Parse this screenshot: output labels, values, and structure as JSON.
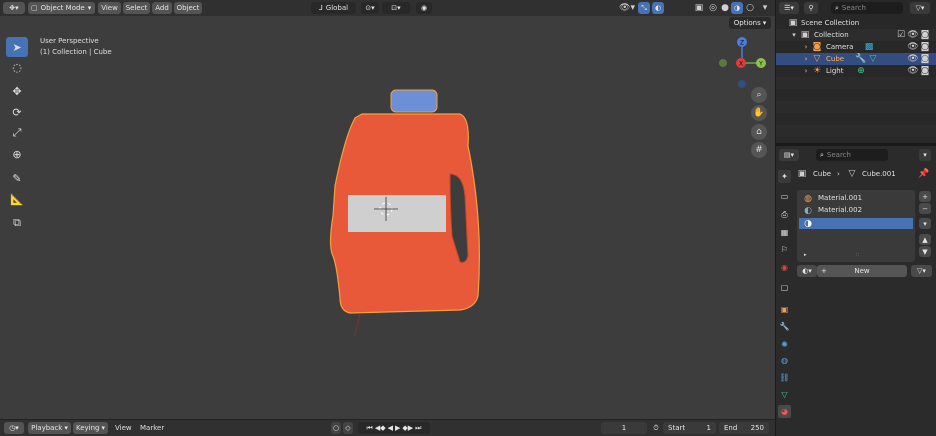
{
  "header": {
    "mode": "Object Mode",
    "menus": [
      "View",
      "Select",
      "Add",
      "Object"
    ],
    "orientation": "Global",
    "search_placeholder": "Search",
    "options": "Options"
  },
  "viewport": {
    "perspective": "User Perspective",
    "collection_info": "(1) Collection | Cube",
    "gizmo": {
      "x": "X",
      "y": "Y",
      "z": "Z"
    }
  },
  "outliner": {
    "search_placeholder": "Search",
    "items": [
      {
        "label": "Scene Collection",
        "icon": "scene-collection-icon"
      },
      {
        "label": "Collection",
        "icon": "collection-icon"
      },
      {
        "label": "Camera",
        "icon": "camera-icon"
      },
      {
        "label": "Cube",
        "icon": "mesh-icon"
      },
      {
        "label": "Light",
        "icon": "light-icon"
      }
    ]
  },
  "properties": {
    "search_placeholder": "Search",
    "breadcrumb": {
      "object": "Cube",
      "mesh": "Cube.001"
    },
    "materials": [
      "Material.001",
      "Material.002",
      ""
    ],
    "new_label": "New"
  },
  "timeline": {
    "playback": "Playback",
    "keying": "Keying",
    "view": "View",
    "marker": "Marker",
    "current_frame": "1",
    "start_label": "Start",
    "start_value": "1",
    "end_label": "End",
    "end_value": "250"
  },
  "colors": {
    "jug": "#e8593a",
    "cap": "#6d8fd8",
    "label": "#cfcfcf",
    "selection": "#4772b3",
    "outline": "#f5a13a"
  }
}
